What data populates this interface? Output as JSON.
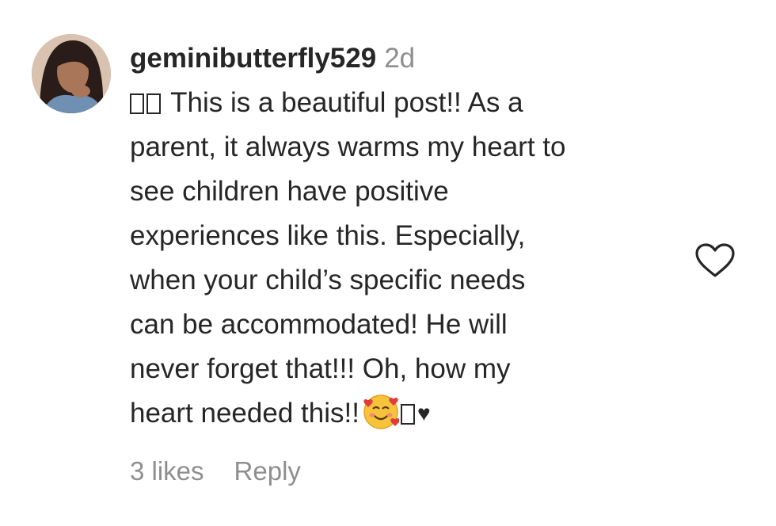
{
  "comment": {
    "username": "geminibutterfly529",
    "timestamp": "2d",
    "text_lines": [
      "This is a beautiful post!! As a",
      "parent, it always warms my heart to",
      "see children have positive",
      "experiences like this. Especially,",
      "when your child’s specific needs",
      "can be accommodated! He will",
      "never forget that!!! Oh, how my",
      "heart needed this!!"
    ],
    "trailing_emojis": {
      "smile": "🥰",
      "heart": "♥"
    },
    "likes": "3 likes",
    "reply_label": "Reply",
    "like_icon": "heart-outline-icon"
  }
}
